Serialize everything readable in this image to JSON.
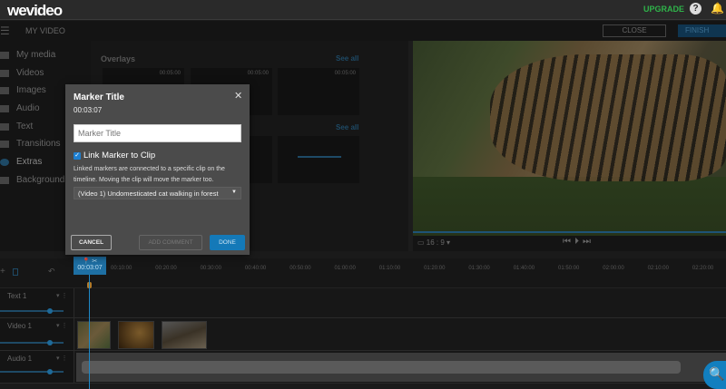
{
  "app": {
    "logo": "wevideo",
    "upgrade": "UPGRADE",
    "help": "?",
    "project_name": "MY VIDEO",
    "close": "CLOSE",
    "finish": "FINISH"
  },
  "sidebar": {
    "items": [
      {
        "label": "My media"
      },
      {
        "label": "Videos"
      },
      {
        "label": "Images"
      },
      {
        "label": "Audio"
      },
      {
        "label": "Text"
      },
      {
        "label": "Transitions"
      },
      {
        "label": "Extras"
      },
      {
        "label": "Backgrounds"
      }
    ]
  },
  "media": {
    "section": "Overlays",
    "see_all": "See all",
    "durations": [
      "00:05:00",
      "00:05:00",
      "00:05:00"
    ]
  },
  "preview": {
    "ratio": "16 : 9"
  },
  "timeline": {
    "ticks": [
      "00:10:00",
      "00:20:00",
      "00:30:00",
      "00:40:00",
      "00:50:00",
      "01:00:00",
      "01:10:00",
      "01:20:00",
      "01:30:00",
      "01:40:00",
      "01:50:00",
      "02:00:00",
      "02:10:00",
      "02:20:00"
    ],
    "marker_time": "00:03:07",
    "tracks": [
      {
        "name": "Text 1"
      },
      {
        "name": "Video 1"
      },
      {
        "name": "Audio 1"
      }
    ]
  },
  "modal": {
    "title": "Marker Title",
    "time": "00:03:07",
    "input_placeholder": "Marker Title",
    "link_label": "Link Marker to Clip",
    "link_checked": true,
    "description": "Linked markers are connected to a specific clip on the timeline. Moving the clip will move the marker too.",
    "clip_select": "(Video 1) Undomesticated cat walking in forest",
    "cancel": "CANCEL",
    "add_comment": "ADD COMMENT",
    "done": "DONE"
  }
}
